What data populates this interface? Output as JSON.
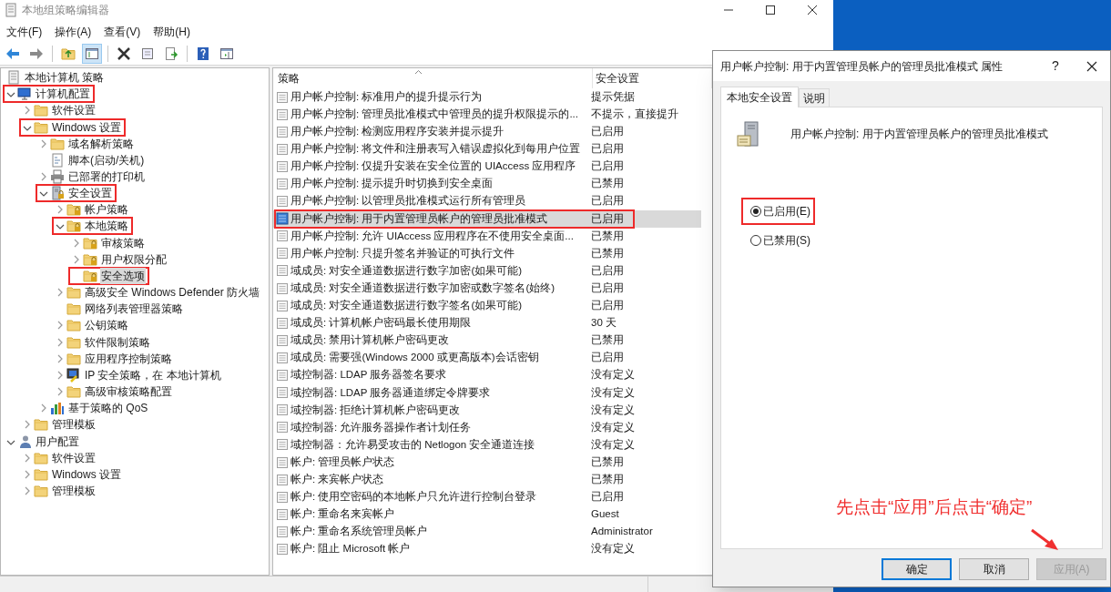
{
  "window": {
    "title": "本地组策略编辑器"
  },
  "menu": [
    "文件(F)",
    "操作(A)",
    "查看(V)",
    "帮助(H)"
  ],
  "toolbar": [
    {
      "kind": "back",
      "pressed": false
    },
    {
      "kind": "forward",
      "pressed": false
    },
    {
      "kind": "separator"
    },
    {
      "kind": "up",
      "pressed": false
    },
    {
      "kind": "tree",
      "pressed": true
    },
    {
      "kind": "separator"
    },
    {
      "kind": "delete",
      "pressed": false
    },
    {
      "kind": "properties",
      "pressed": false
    },
    {
      "kind": "export",
      "pressed": false
    },
    {
      "kind": "separator"
    },
    {
      "kind": "help",
      "pressed": false
    },
    {
      "kind": "pane",
      "pressed": false
    }
  ],
  "tree": [
    {
      "label": "本地计算机 策略",
      "kind": "policy",
      "selected": false,
      "highlighted": false,
      "children": [
        {
          "label": "计算机配置",
          "kind": "computer",
          "expandable": true,
          "expanded": true,
          "selected": false,
          "highlighted": true,
          "children": [
            {
              "label": "软件设置",
              "kind": "folder",
              "expandable": true,
              "expanded": false,
              "selected": false,
              "highlighted": false
            },
            {
              "label": "Windows 设置",
              "kind": "folder",
              "expandable": true,
              "expanded": true,
              "selected": false,
              "highlighted": true,
              "children": [
                {
                  "label": "域名解析策略",
                  "kind": "folder",
                  "expandable": true,
                  "expanded": false,
                  "selected": false,
                  "highlighted": false
                },
                {
                  "label": "脚本(启动/关机)",
                  "kind": "script",
                  "expandable": false,
                  "selected": false,
                  "highlighted": false
                },
                {
                  "label": "已部署的打印机",
                  "kind": "printer",
                  "expandable": true,
                  "expanded": false,
                  "selected": false,
                  "highlighted": false
                },
                {
                  "label": "安全设置",
                  "kind": "security",
                  "expandable": true,
                  "expanded": true,
                  "selected": false,
                  "highlighted": true,
                  "children": [
                    {
                      "label": "帐户策略",
                      "kind": "lockfolder",
                      "expandable": true,
                      "expanded": false,
                      "selected": false,
                      "highlighted": false
                    },
                    {
                      "label": "本地策略",
                      "kind": "lockfolder",
                      "expandable": true,
                      "expanded": true,
                      "selected": false,
                      "highlighted": true,
                      "children": [
                        {
                          "label": "审核策略",
                          "kind": "lockfolder",
                          "expandable": true,
                          "expanded": false,
                          "selected": false,
                          "highlighted": false
                        },
                        {
                          "label": "用户权限分配",
                          "kind": "lockfolder",
                          "expandable": true,
                          "expanded": false,
                          "selected": false,
                          "highlighted": false
                        },
                        {
                          "label": "安全选项",
                          "kind": "lockfolder",
                          "expandable": false,
                          "selected": true,
                          "highlighted": true
                        }
                      ]
                    },
                    {
                      "label": "高级安全 Windows Defender 防火墙",
                      "kind": "folder",
                      "expandable": true,
                      "expanded": false,
                      "selected": false,
                      "highlighted": false
                    },
                    {
                      "label": "网络列表管理器策略",
                      "kind": "folder",
                      "expandable": false,
                      "selected": false,
                      "highlighted": false
                    },
                    {
                      "label": "公钥策略",
                      "kind": "folder",
                      "expandable": true,
                      "expanded": false,
                      "selected": false,
                      "highlighted": false
                    },
                    {
                      "label": "软件限制策略",
                      "kind": "folder",
                      "expandable": true,
                      "expanded": false,
                      "selected": false,
                      "highlighted": false
                    },
                    {
                      "label": "应用程序控制策略",
                      "kind": "folder",
                      "expandable": true,
                      "expanded": false,
                      "selected": false,
                      "highlighted": false
                    },
                    {
                      "label": "IP 安全策略，在 本地计算机",
                      "kind": "ip",
                      "expandable": true,
                      "expanded": false,
                      "selected": false,
                      "highlighted": false
                    },
                    {
                      "label": "高级审核策略配置",
                      "kind": "folder",
                      "expandable": true,
                      "expanded": false,
                      "selected": false,
                      "highlighted": false
                    }
                  ]
                },
                {
                  "label": "基于策略的 QoS",
                  "kind": "chart",
                  "expandable": true,
                  "expanded": false,
                  "selected": false,
                  "highlighted": false
                }
              ]
            },
            {
              "label": "管理模板",
              "kind": "folder",
              "expandable": true,
              "expanded": false,
              "selected": false,
              "highlighted": false
            }
          ]
        },
        {
          "label": "用户配置",
          "kind": "user",
          "expandable": true,
          "expanded": true,
          "selected": false,
          "highlighted": false,
          "children": [
            {
              "label": "软件设置",
              "kind": "folder",
              "expandable": true,
              "expanded": false,
              "selected": false,
              "highlighted": false
            },
            {
              "label": "Windows 设置",
              "kind": "folder",
              "expandable": true,
              "expanded": false,
              "selected": false,
              "highlighted": false
            },
            {
              "label": "管理模板",
              "kind": "folder",
              "expandable": true,
              "expanded": false,
              "selected": false,
              "highlighted": false
            }
          ]
        }
      ]
    }
  ],
  "table": {
    "columns": [
      "策略",
      "安全设置"
    ],
    "rows": [
      {
        "policy": "用户帐户控制: 标准用户的提升提示行为",
        "setting": "提示凭据",
        "selected": false,
        "highlighted": false
      },
      {
        "policy": "用户帐户控制: 管理员批准模式中管理员的提升权限提示的...",
        "setting": "不提示，直接提升",
        "selected": false,
        "highlighted": false
      },
      {
        "policy": "用户帐户控制: 检测应用程序安装并提示提升",
        "setting": "已启用",
        "selected": false,
        "highlighted": false
      },
      {
        "policy": "用户帐户控制: 将文件和注册表写入错误虚拟化到每用户位置",
        "setting": "已启用",
        "selected": false,
        "highlighted": false
      },
      {
        "policy": "用户帐户控制: 仅提升安装在安全位置的 UIAccess 应用程序",
        "setting": "已启用",
        "selected": false,
        "highlighted": false
      },
      {
        "policy": "用户帐户控制: 提示提升时切换到安全桌面",
        "setting": "已禁用",
        "selected": false,
        "highlighted": false
      },
      {
        "policy": "用户帐户控制: 以管理员批准模式运行所有管理员",
        "setting": "已启用",
        "selected": false,
        "highlighted": false
      },
      {
        "policy": "用户帐户控制: 用于内置管理员帐户的管理员批准模式",
        "setting": "已启用",
        "selected": true,
        "highlighted": true
      },
      {
        "policy": "用户帐户控制: 允许 UIAccess 应用程序在不使用安全桌面...",
        "setting": "已禁用",
        "selected": false,
        "highlighted": false
      },
      {
        "policy": "用户帐户控制: 只提升签名并验证的可执行文件",
        "setting": "已禁用",
        "selected": false,
        "highlighted": false
      },
      {
        "policy": "域成员: 对安全通道数据进行数字加密(如果可能)",
        "setting": "已启用",
        "selected": false,
        "highlighted": false
      },
      {
        "policy": "域成员: 对安全通道数据进行数字加密或数字签名(始终)",
        "setting": "已启用",
        "selected": false,
        "highlighted": false
      },
      {
        "policy": "域成员: 对安全通道数据进行数字签名(如果可能)",
        "setting": "已启用",
        "selected": false,
        "highlighted": false
      },
      {
        "policy": "域成员: 计算机帐户密码最长使用期限",
        "setting": "30 天",
        "selected": false,
        "highlighted": false
      },
      {
        "policy": "域成员: 禁用计算机帐户密码更改",
        "setting": "已禁用",
        "selected": false,
        "highlighted": false
      },
      {
        "policy": "域成员: 需要强(Windows 2000 或更高版本)会话密钥",
        "setting": "已启用",
        "selected": false,
        "highlighted": false
      },
      {
        "policy": "域控制器: LDAP 服务器签名要求",
        "setting": "没有定义",
        "selected": false,
        "highlighted": false
      },
      {
        "policy": "域控制器: LDAP 服务器通道绑定令牌要求",
        "setting": "没有定义",
        "selected": false,
        "highlighted": false
      },
      {
        "policy": "域控制器: 拒绝计算机帐户密码更改",
        "setting": "没有定义",
        "selected": false,
        "highlighted": false
      },
      {
        "policy": "域控制器: 允许服务器操作者计划任务",
        "setting": "没有定义",
        "selected": false,
        "highlighted": false
      },
      {
        "policy": "域控制器：允许易受攻击的 Netlogon 安全通道连接",
        "setting": "没有定义",
        "selected": false,
        "highlighted": false
      },
      {
        "policy": "帐户: 管理员帐户状态",
        "setting": "已禁用",
        "selected": false,
        "highlighted": false
      },
      {
        "policy": "帐户: 来宾帐户状态",
        "setting": "已禁用",
        "selected": false,
        "highlighted": false
      },
      {
        "policy": "帐户: 使用空密码的本地帐户只允许进行控制台登录",
        "setting": "已启用",
        "selected": false,
        "highlighted": false
      },
      {
        "policy": "帐户: 重命名来宾帐户",
        "setting": "Guest",
        "selected": false,
        "highlighted": false
      },
      {
        "policy": "帐户: 重命名系统管理员帐户",
        "setting": "Administrator",
        "selected": false,
        "highlighted": false
      },
      {
        "policy": "帐户: 阻止 Microsoft 帐户",
        "setting": "没有定义",
        "selected": false,
        "highlighted": false
      }
    ]
  },
  "dialog": {
    "title": "用户帐户控制: 用于内置管理员帐户的管理员批准模式 属性",
    "help": "?",
    "tabs": [
      {
        "label": "本地安全设置",
        "selected": true
      },
      {
        "label": "说明",
        "selected": false
      }
    ],
    "policy_name": "用户帐户控制: 用于内置管理员帐户的管理员批准模式",
    "options": [
      {
        "label": "已启用(E)",
        "checked": true,
        "highlighted": true
      },
      {
        "label": "已禁用(S)",
        "checked": false,
        "highlighted": false
      }
    ],
    "buttons": [
      {
        "label": "确定",
        "kind": "default"
      },
      {
        "label": "取消",
        "kind": "normal"
      },
      {
        "label": "应用(A)",
        "kind": "disabled"
      }
    ]
  },
  "annotation": {
    "text": "先点击“应用”后点击“确定”"
  }
}
